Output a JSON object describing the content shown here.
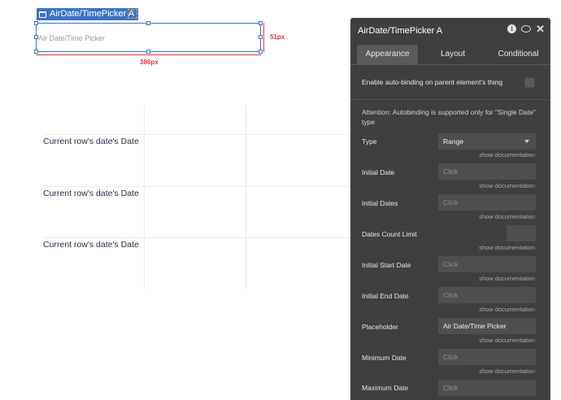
{
  "selected_element": {
    "tag_label": "AirDate/TimePicker A",
    "badge_text": "##",
    "placeholder": "Air Date/Time Picker",
    "width_label": "386px",
    "height_label": "51px"
  },
  "repeating_group": {
    "rows": [
      {
        "text": "Current row's date's Date"
      },
      {
        "text": "Current row's date's Date"
      },
      {
        "text": "Current row's date's Date"
      }
    ]
  },
  "panel": {
    "title": "AirDate/TimePicker A",
    "tabs": [
      {
        "label": "Appearance"
      },
      {
        "label": "Layout"
      },
      {
        "label": "Conditional"
      }
    ],
    "autobinding_label": "Enable auto-binding on parent element's thing",
    "attention_note": "Attention: Autobinding is supported only for \"Single Date\" type",
    "show_documentation": "show documentation",
    "fields": [
      {
        "label": "Type",
        "value": "Range"
      },
      {
        "label": "Initial Date",
        "value": "Click"
      },
      {
        "label": "Initial Dates",
        "value": "Click"
      },
      {
        "label": "Dates Count Limit",
        "value": ""
      },
      {
        "label": "Initial Start Date",
        "value": "Click"
      },
      {
        "label": "Initial End Date",
        "value": "Click"
      },
      {
        "label": "Placeholder",
        "value": "Air Date/Time Picker"
      },
      {
        "label": "Minimum Date",
        "value": "Click"
      },
      {
        "label": "Maximum Date",
        "value": "Click"
      }
    ]
  }
}
